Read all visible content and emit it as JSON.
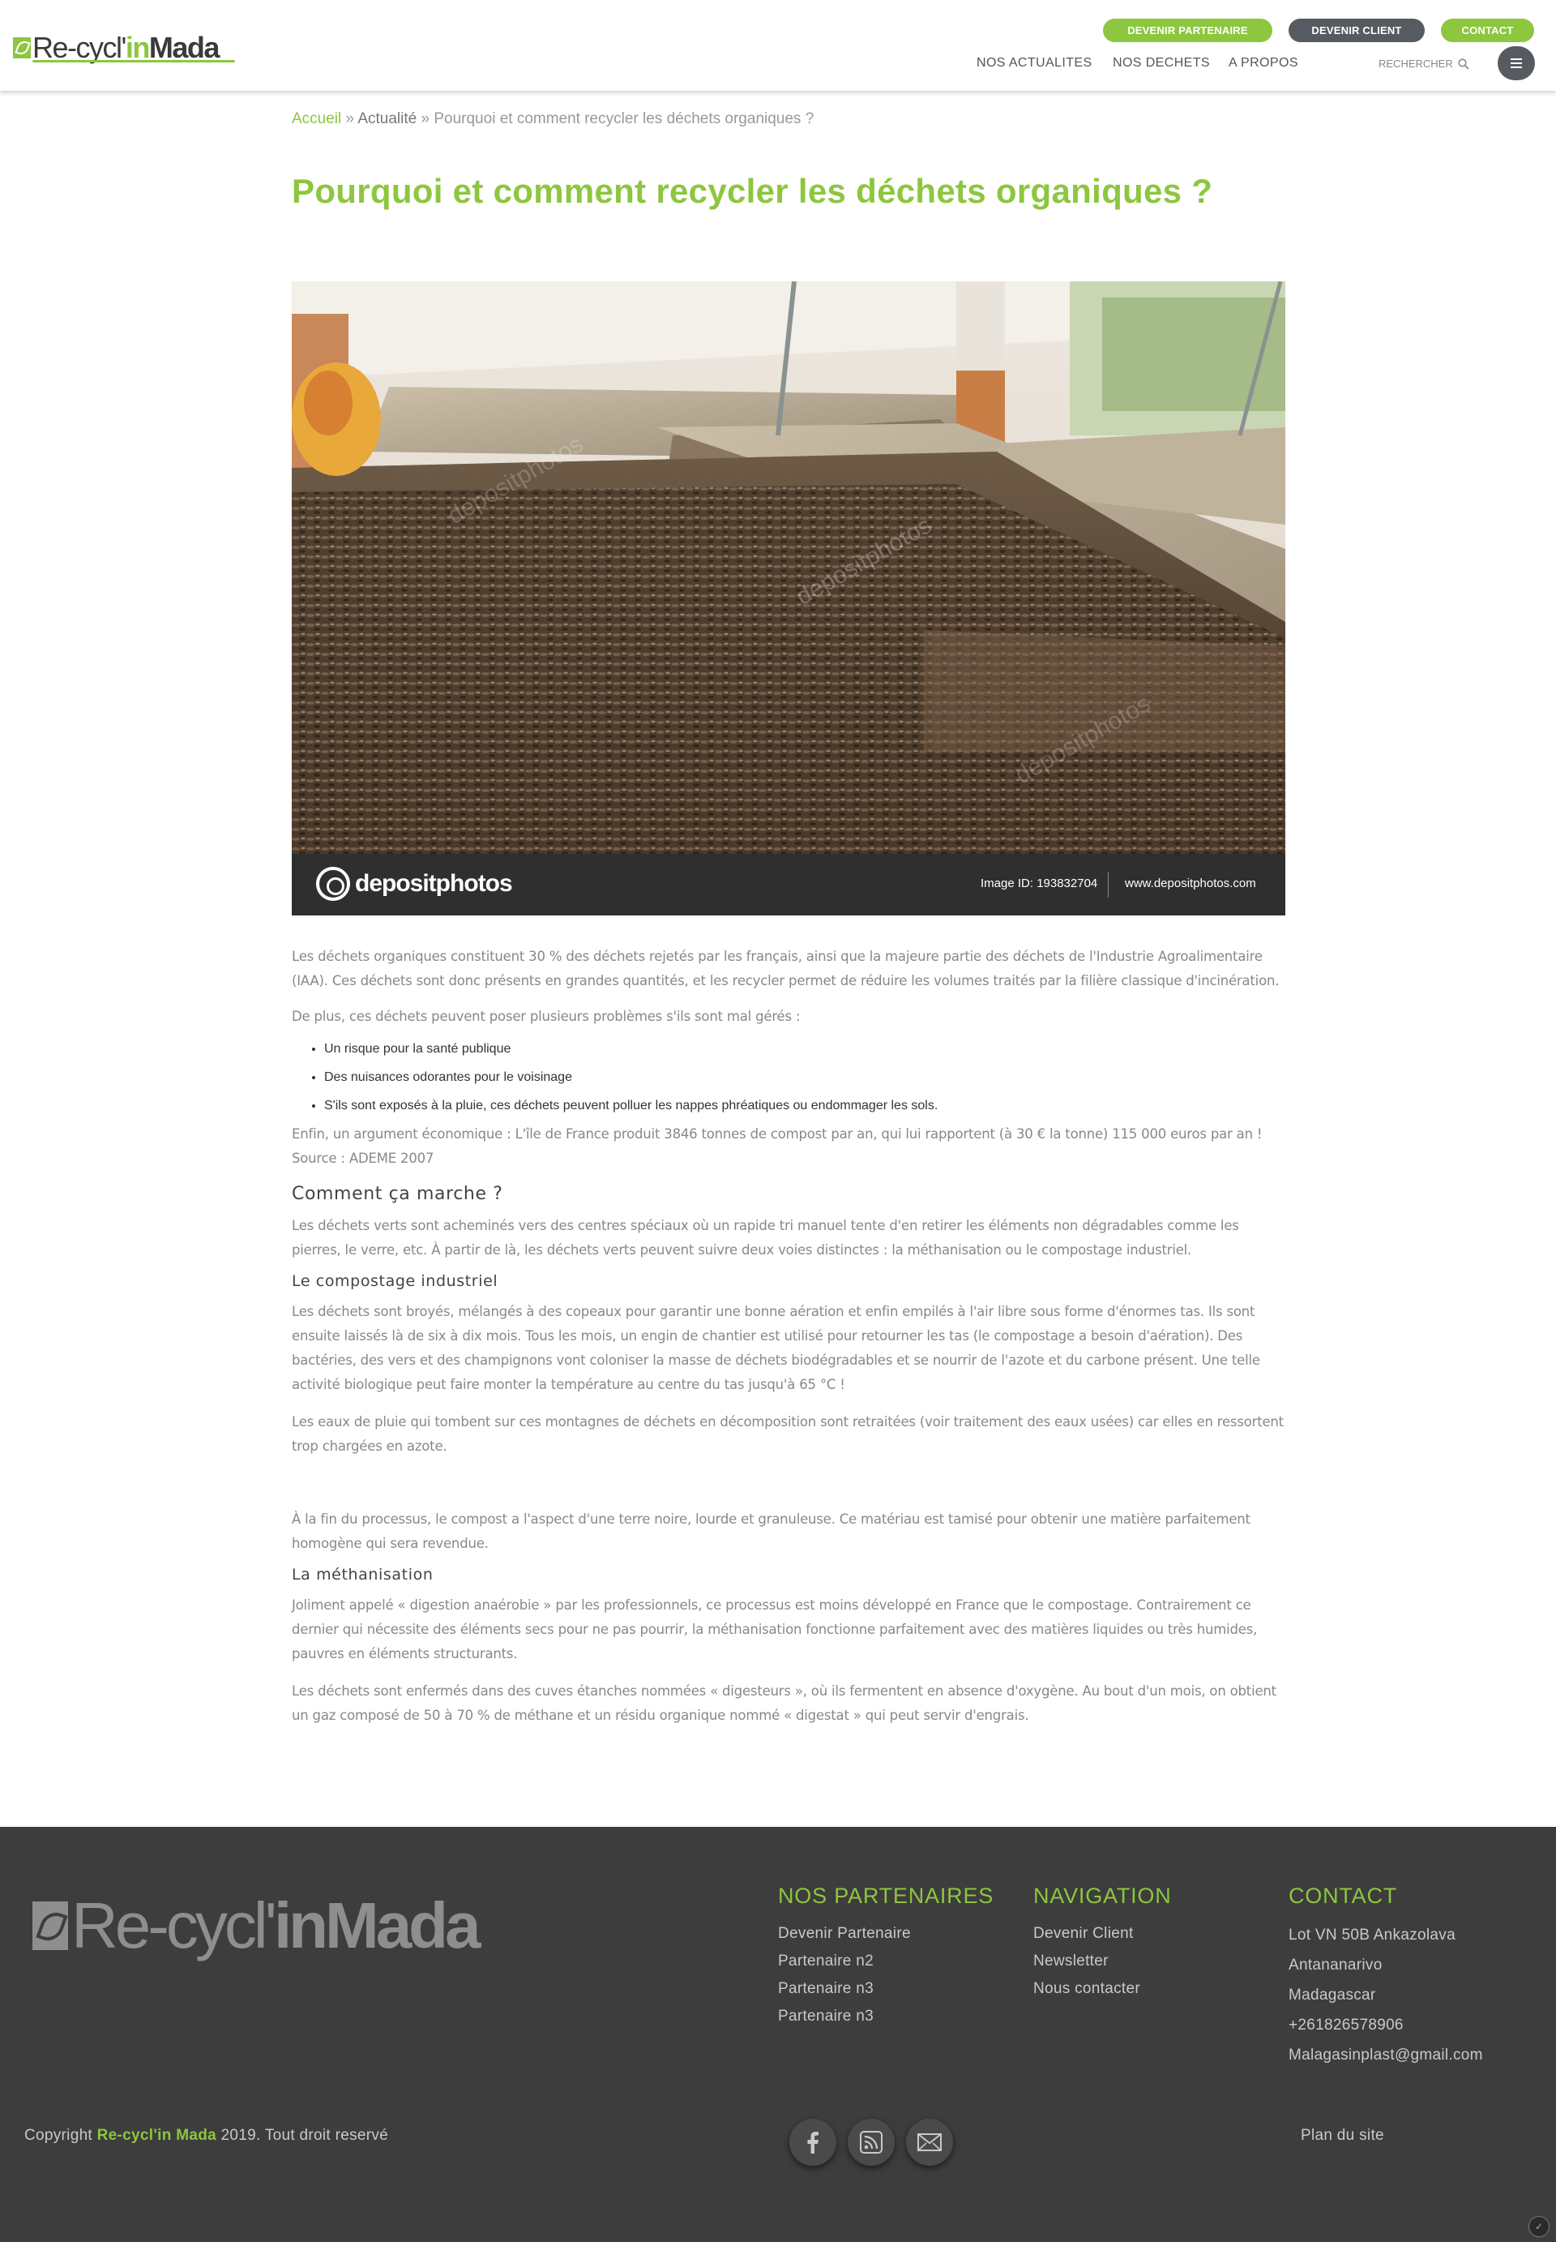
{
  "header": {
    "logo": {
      "part1": "Re-cycl'",
      "part2": "in",
      "part3": "Mada"
    },
    "buttons": {
      "partner": "DEVENIR PARTENAIRE",
      "client": "DEVENIR CLIENT",
      "contact": "CONTACT"
    },
    "nav": {
      "news": "NOS ACTUALITES",
      "waste": "NOS DECHETS",
      "about": "A PROPOS"
    },
    "search_label": "RECHERCHER",
    "colors": {
      "accent": "#8dc63f",
      "dark_button": "#555b60"
    }
  },
  "breadcrumb": {
    "home": "Accueil",
    "sep": "»",
    "section": "Actualité",
    "current": "Pourquoi et comment recycler les déchets organiques ?"
  },
  "article": {
    "title": "Pourquoi et comment recycler les déchets organiques ?",
    "image": {
      "brand": "depositphotos",
      "image_id": "Image ID: 193832704",
      "url": "www.depositphotos.com"
    },
    "p1": "Les déchets organiques constituent 30 % des déchets rejetés par les français, ainsi que la majeure partie des déchets de l'Industrie Agroalimentaire (IAA). Ces déchets sont donc présents en grandes quantités, et les recycler permet de réduire les volumes traités par la filière classique d'incinération.",
    "p2": "De plus, ces déchets peuvent poser plusieurs problèmes s'ils sont mal gérés :",
    "list": [
      "Un risque pour la santé publique",
      "Des nuisances odorantes pour le voisinage",
      "S'ils sont exposés à la pluie, ces déchets peuvent polluer les nappes phréatiques ou endommager les sols."
    ],
    "p3": "Enfin, un argument économique : L'île de France produit 3846 tonnes de compost par an, qui lui rapportent (à 30 € la tonne) 115 000 euros par an ! Source : ADEME 2007",
    "h2": "Comment ça marche ?",
    "p4": "Les déchets verts sont acheminés vers des centres spéciaux où un rapide tri manuel tente d'en retirer les éléments non dégradables comme les pierres, le verre, etc. À partir de là, les déchets verts peuvent suivre deux voies distinctes : la méthanisation ou le compostage industriel.",
    "h3a": "Le compostage industriel",
    "p5": "Les déchets sont broyés, mélangés à des copeaux pour garantir une bonne aération et enfin empilés à l'air libre sous forme d'énormes tas. Ils sont ensuite laissés là de six à dix mois. Tous les mois, un engin de chantier est utilisé pour retourner les tas (le compostage a besoin d'aération). Des bactéries, des vers et des champignons vont coloniser la masse de déchets biodégradables et se nourrir de l'azote et du carbone présent. Une telle activité biologique peut faire monter la température au centre du tas jusqu'à 65 °C !",
    "p6": "Les eaux de pluie qui tombent sur ces montagnes de déchets en décomposition sont retraitées (voir traitement des eaux usées) car elles en ressortent trop chargées en azote.",
    "p7": "À la fin du processus, le compost a l'aspect d'une terre noire, lourde et granuleuse. Ce matériau est tamisé pour obtenir une matière parfaitement homogène qui sera revendue.",
    "h3b": "La méthanisation",
    "p8": "Joliment appelé « digestion anaérobie » par les professionnels, ce processus est moins développé en France que le compostage. Contrairement ce dernier qui nécessite des éléments secs pour ne pas pourrir, la méthanisation fonctionne parfaitement avec des matières liquides ou très humides, pauvres en éléments structurants.",
    "p9": "Les déchets sont enfermés dans des cuves étanches nommées « digesteurs », où ils fermentent en absence d'oxygène.  Au bout d'un mois, on obtient un gaz composé de 50 à 70 % de méthane et un résidu organique nommé « digestat » qui peut servir d'engrais."
  },
  "footer": {
    "logo": {
      "part1": "Re-cycl'",
      "part2": "inMada"
    },
    "partners": {
      "title": "NOS PARTENAIRES",
      "links": [
        "Devenir Partenaire",
        "Partenaire n2",
        "Partenaire n3",
        "Partenaire n3"
      ]
    },
    "navigation": {
      "title": "NAVIGATION",
      "links": [
        "Devenir Client",
        "Newsletter",
        "Nous contacter"
      ]
    },
    "contact": {
      "title": "CONTACT",
      "lines": [
        "Lot VN 50B Ankazolava",
        "Antananarivo",
        "Madagascar",
        "+261826578906",
        "Malagasinplast@gmail.com"
      ]
    },
    "copyright": {
      "prefix": "Copyright",
      "brand": "Re-cycl'in Mada",
      "suffix": "2019. Tout droit reservé"
    },
    "social_icons": [
      "facebook-icon",
      "rss-icon",
      "mail-icon"
    ],
    "sitemap": "Plan du site",
    "background": "#3d3d3d"
  }
}
